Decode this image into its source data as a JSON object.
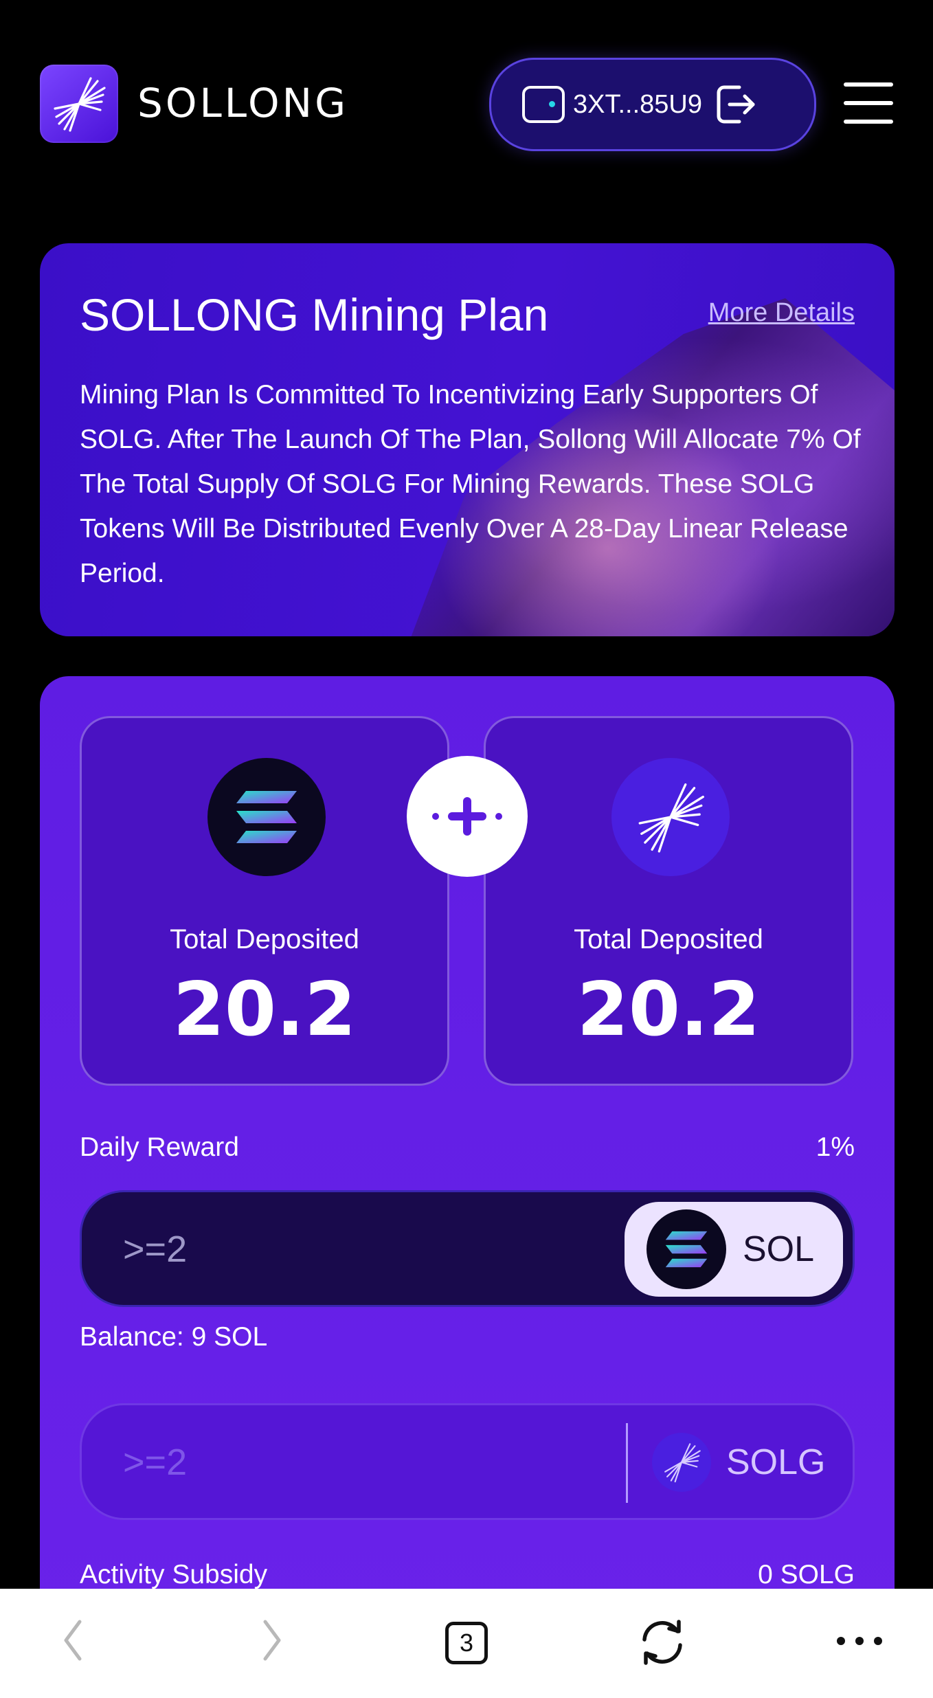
{
  "header": {
    "brand": "SOLLONG",
    "wallet_address": "3XT...85U9",
    "icons": {
      "logo": "sollong-logo-icon",
      "wallet": "wallet-icon",
      "logout": "logout-icon",
      "menu": "hamburger-menu-icon"
    }
  },
  "plan": {
    "title": "SOLLONG Mining Plan",
    "more_link": "More Details",
    "description": "Mining Plan Is Committed To Incentivizing Early Supporters Of SOLG. After The Launch Of The Plan, Sollong Will Allocate 7% Of The Total Supply Of SOLG For Mining Rewards. These SOLG Tokens Will Be Distributed Evenly Over A 28-Day Linear Release Period."
  },
  "deposits": [
    {
      "token": "SOL",
      "label": "Total Deposited",
      "value": "20.2"
    },
    {
      "token": "SOLG",
      "label": "Total Deposited",
      "value": "20.2"
    }
  ],
  "daily_reward": {
    "label": "Daily Reward",
    "value": "1%"
  },
  "sol_input": {
    "placeholder": ">=2",
    "token": "SOL"
  },
  "balance": "Balance: 9 SOL",
  "solg_input": {
    "placeholder": ">=2",
    "token": "SOLG"
  },
  "activity_subsidy": {
    "label": "Activity Subsidy",
    "value": "0 SOLG"
  },
  "browser_toolbar": {
    "tab_count": "3"
  },
  "colors": {
    "accent": "#6a22ea",
    "card": "#3b0fc8",
    "input_dark": "#190a4c",
    "teal": "#27d7e8"
  }
}
